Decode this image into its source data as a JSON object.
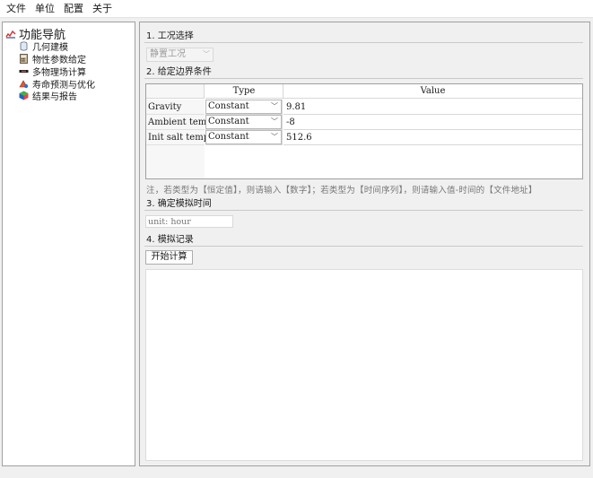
{
  "menubar": {
    "items": [
      "文件",
      "单位",
      "配置",
      "关于"
    ]
  },
  "nav": {
    "root_label": "功能导航",
    "root_icon": "chart-icon",
    "items": [
      {
        "label": "几何建模",
        "icon": "cylinder-icon"
      },
      {
        "label": "物性参数给定",
        "icon": "calculator-icon"
      },
      {
        "label": "多物理场计算",
        "icon": "flow-icon"
      },
      {
        "label": "寿命预测与优化",
        "icon": "lifecycle-icon"
      },
      {
        "label": "结果与报告",
        "icon": "report-icon"
      }
    ]
  },
  "sections": {
    "s1_title": "1. 工况选择",
    "s2_title": "2. 给定边界条件",
    "s3_title": "3. 确定模拟时间",
    "s4_title": "4. 模拟记录"
  },
  "condition_combo": {
    "value": "静置工况"
  },
  "bc_table": {
    "headers": {
      "type": "Type",
      "value": "Value"
    },
    "rows": [
      {
        "name": "Gravity",
        "type": "Constant",
        "value": "9.81"
      },
      {
        "name": "Ambient temp",
        "type": "Constant",
        "value": "-8"
      },
      {
        "name": "Init salt temp",
        "type": "Constant",
        "value": "512.6"
      }
    ]
  },
  "note": "注，若类型为【恒定值】，则请输入【数字】；若类型为【时间序列】，则请输入值-时间的【文件地址】",
  "time_input": {
    "placeholder": "unit: hour",
    "value": ""
  },
  "start_button": "开始计算",
  "log": ""
}
